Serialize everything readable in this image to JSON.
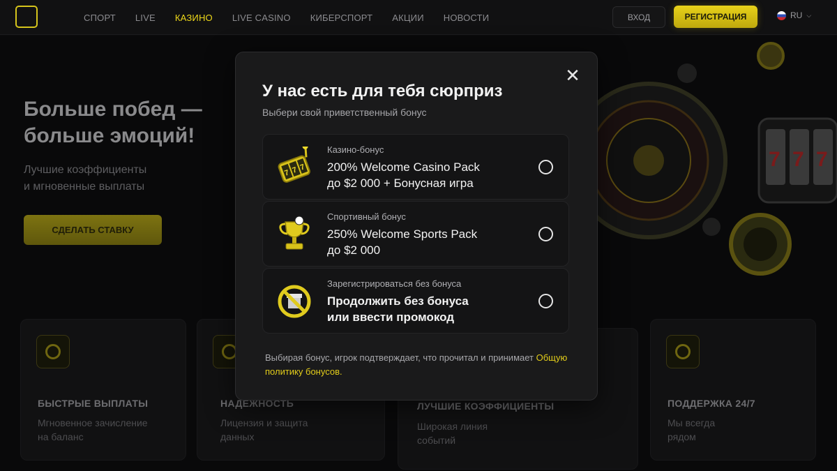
{
  "header": {
    "nav": [
      "СПОРТ",
      "LIVE",
      "КАЗИНО",
      "LIVE CASINO",
      "КИБЕРСПОРТ",
      "АКЦИИ",
      "НОВОСТИ"
    ],
    "active_nav": "КАЗИНО",
    "login_label": "ВХОД",
    "register_label": "РЕГИСТРАЦИЯ",
    "language": "RU",
    "accent_color": "#e3cd1a"
  },
  "hero": {
    "title_line1": "Больше побед —",
    "title_line2": "больше эмоций!",
    "subtitle_line1": "Лучшие коэффициенты",
    "subtitle_line2": "и мгновенные выплаты",
    "cta_label": "СДЕЛАТЬ СТАВКУ"
  },
  "features": [
    {
      "title": "БЫСТРЫЕ ВЫПЛАТЫ",
      "text_line1": "Мгновенное зачисление",
      "text_line2": "на баланс"
    },
    {
      "title": "НАДЕЖНОСТЬ",
      "text_line1": "Лицензия и защита",
      "text_line2": "данных"
    },
    {
      "title": "ЛУЧШИЕ КОЭФФИЦИЕНТЫ",
      "text_line1": "Широкая линия",
      "text_line2": "событий"
    },
    {
      "title": "ПОДДЕРЖКА 24/7",
      "text_line1": "Мы всегда",
      "text_line2": "рядом"
    }
  ],
  "modal": {
    "title": "У нас есть для тебя сюрприз",
    "subtitle": "Выбери свой приветственный бонус",
    "options": [
      {
        "category": "Казино-бонус",
        "line1": "200% Welcome Casino Pack",
        "line2": "до $2 000 + Бонусная игра",
        "icon": "slot-machine-icon",
        "selected": false
      },
      {
        "category": "Спортивный бонус",
        "line1": "250% Welcome Sports Pack",
        "line2": "до $2 000",
        "icon": "trophy-icon",
        "selected": false
      },
      {
        "category": "Зарегистрироваться без бонуса",
        "line1": "Продолжить без бонуса",
        "line2": "или ввести промокод",
        "icon": "no-gift-icon",
        "selected": false
      }
    ],
    "note_text": "Выбирая бонус, игрок подтверждает, что прочитал и принимает ",
    "note_link": "Общую политику бонусов."
  }
}
